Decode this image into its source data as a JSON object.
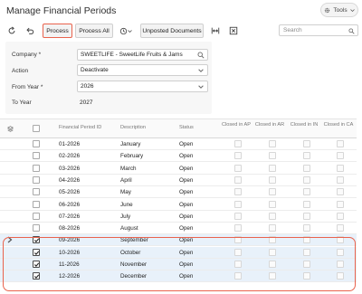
{
  "page": {
    "title": "Manage Financial Periods",
    "tools_label": "Tools"
  },
  "toolbar": {
    "process_label": "Process",
    "process_all_label": "Process All",
    "unposted_label": "Unposted Documents",
    "search_placeholder": "Search"
  },
  "form": {
    "company_label": "Company",
    "company_value": "SWEETLIFE - SweetLife Fruits & Jams",
    "action_label": "Action",
    "action_value": "Deactivate",
    "from_year_label": "From Year",
    "from_year_value": "2026",
    "to_year_label": "To Year",
    "to_year_value": "2027",
    "required_mark": "*"
  },
  "grid": {
    "headers": {
      "period_id": "Financial Period ID",
      "description": "Description",
      "status": "Status",
      "closed_ap": "Closed in AP",
      "closed_ar": "Closed in AR",
      "closed_in": "Closed in IN",
      "closed_ca": "Closed in CA"
    },
    "rows": [
      {
        "id": "01-2026",
        "desc": "January",
        "status": "Open",
        "selected": false
      },
      {
        "id": "02-2026",
        "desc": "February",
        "status": "Open",
        "selected": false
      },
      {
        "id": "03-2026",
        "desc": "March",
        "status": "Open",
        "selected": false
      },
      {
        "id": "04-2026",
        "desc": "April",
        "status": "Open",
        "selected": false
      },
      {
        "id": "05-2026",
        "desc": "May",
        "status": "Open",
        "selected": false
      },
      {
        "id": "06-2026",
        "desc": "June",
        "status": "Open",
        "selected": false
      },
      {
        "id": "07-2026",
        "desc": "July",
        "status": "Open",
        "selected": false
      },
      {
        "id": "08-2026",
        "desc": "August",
        "status": "Open",
        "selected": false
      },
      {
        "id": "09-2026",
        "desc": "September",
        "status": "Open",
        "selected": true,
        "current": true
      },
      {
        "id": "10-2026",
        "desc": "October",
        "status": "Open",
        "selected": true
      },
      {
        "id": "11-2026",
        "desc": "November",
        "status": "Open",
        "selected": true
      },
      {
        "id": "12-2026",
        "desc": "December",
        "status": "Open",
        "selected": true
      }
    ]
  },
  "colors": {
    "highlight": "#e9634d",
    "selected_row": "#e8f1fa"
  }
}
